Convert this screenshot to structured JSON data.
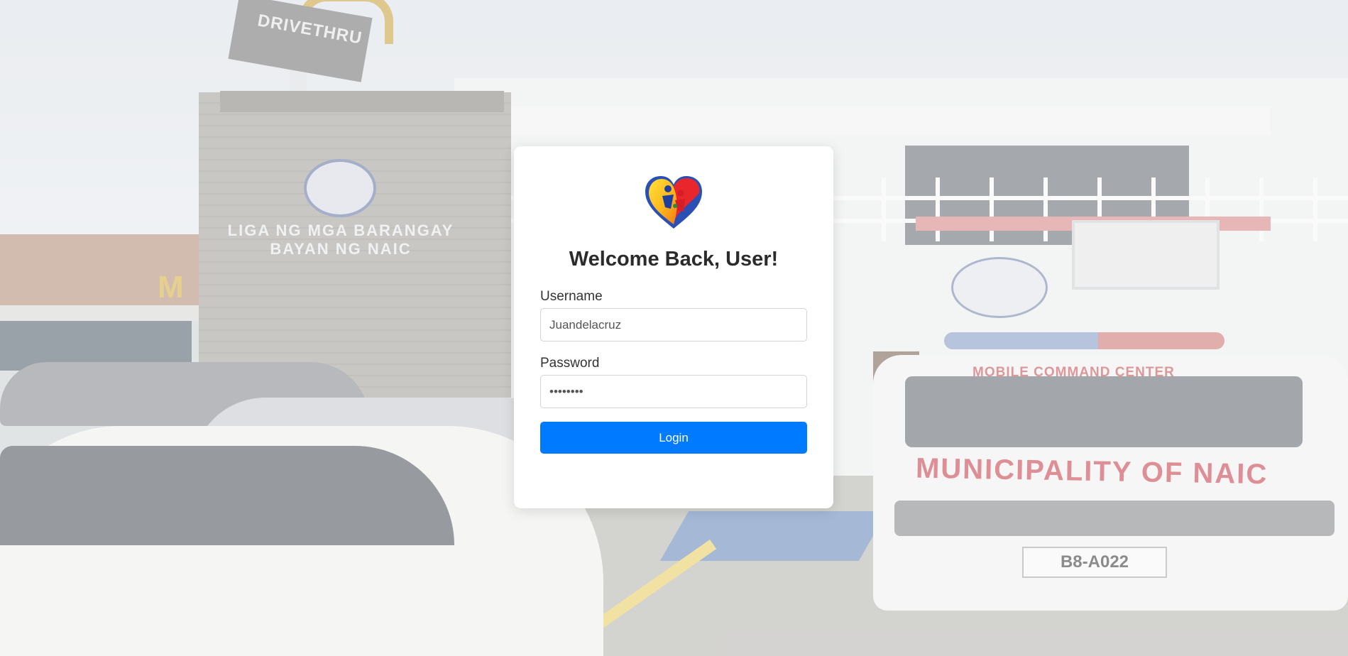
{
  "background": {
    "sign_drive": "DRIVETHRU",
    "wall_text_line1": "LIGA NG MGA BARANGAY",
    "wall_text_line2": "BAYAN NG NAIC",
    "banner_top": "MOBILE COMMAND CENTER",
    "banner_main": "MUNICIPALITY OF NAIC",
    "plate": "B8-A022"
  },
  "login": {
    "logo_icon": "heart-family-logo-icon",
    "title": "Welcome Back, User!",
    "username_label": "Username",
    "username_value": "Juandelacruz",
    "password_label": "Password",
    "password_value": "••••••••",
    "login_button": "Login"
  },
  "colors": {
    "button": "#007bff",
    "card": "#ffffff",
    "title": "#2b2b2b"
  }
}
